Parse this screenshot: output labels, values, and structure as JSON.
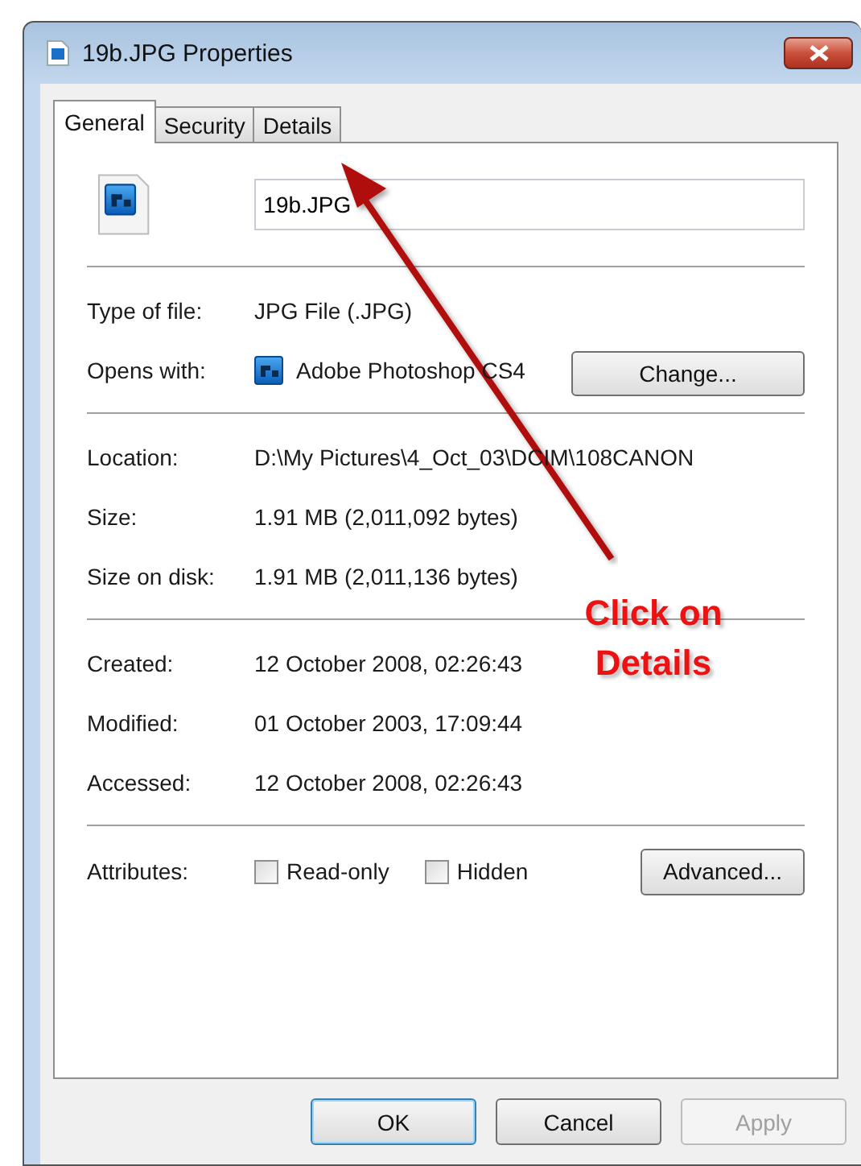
{
  "window": {
    "title": "19b.JPG Properties"
  },
  "tabs": [
    {
      "label": "General",
      "selected": true
    },
    {
      "label": "Security",
      "selected": false
    },
    {
      "label": "Details",
      "selected": false
    }
  ],
  "file_name": {
    "value": "19b.JPG"
  },
  "sections": [
    [
      {
        "label": "Type of file:",
        "value": "JPG File (.JPG)",
        "kind": "text"
      },
      {
        "label": "Opens with:",
        "value": "Adobe Photoshop CS4",
        "kind": "app",
        "button": "Change..."
      }
    ],
    [
      {
        "label": "Location:",
        "value": "D:\\My Pictures\\4_Oct_03\\DCIM\\108CANON",
        "kind": "text"
      },
      {
        "label": "Size:",
        "value": "1.91 MB (2,011,092 bytes)",
        "kind": "text"
      },
      {
        "label": "Size on disk:",
        "value": "1.91 MB (2,011,136 bytes)",
        "kind": "text"
      }
    ],
    [
      {
        "label": "Created:",
        "value": "12 October 2008, 02:26:43",
        "kind": "text"
      },
      {
        "label": "Modified:",
        "value": "01 October 2003, 17:09:44",
        "kind": "text"
      },
      {
        "label": "Accessed:",
        "value": "12 October 2008, 02:26:43",
        "kind": "text"
      }
    ]
  ],
  "attributes": {
    "label": "Attributes:",
    "checkboxes": [
      {
        "label": "Read-only",
        "checked": false
      },
      {
        "label": "Hidden",
        "checked": false
      }
    ],
    "button": "Advanced..."
  },
  "buttons": [
    {
      "label": "OK",
      "default": true,
      "disabled": false
    },
    {
      "label": "Cancel",
      "default": false,
      "disabled": false
    },
    {
      "label": "Apply",
      "default": false,
      "disabled": true
    }
  ],
  "annotation": {
    "lines": [
      "Click on",
      "Details"
    ]
  }
}
